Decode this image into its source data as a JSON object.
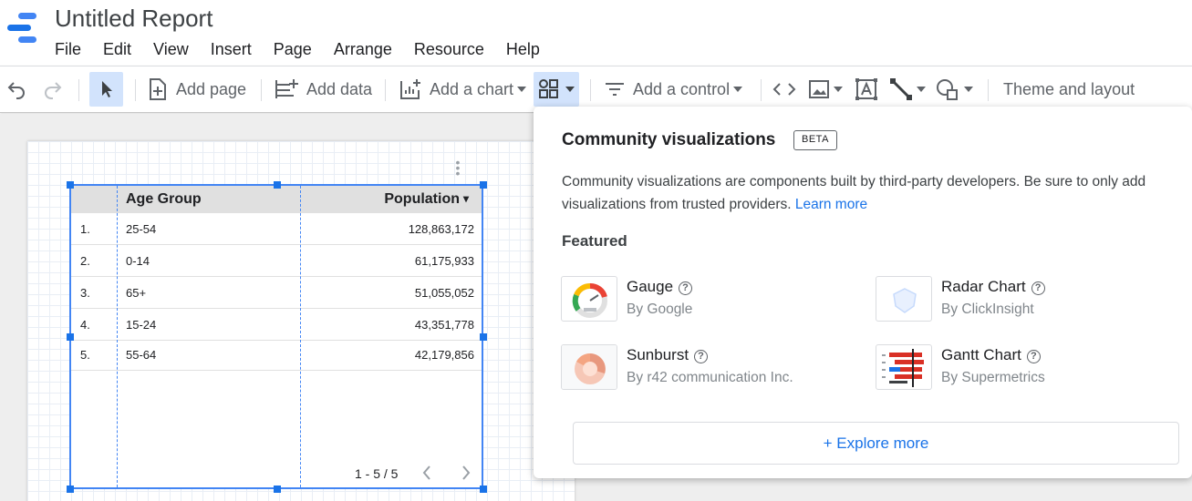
{
  "app": {
    "title": "Untitled Report"
  },
  "menu": [
    "File",
    "Edit",
    "View",
    "Insert",
    "Page",
    "Arrange",
    "Resource",
    "Help"
  ],
  "toolbar": {
    "add_page": "Add page",
    "add_data": "Add data",
    "add_chart": "Add a chart",
    "add_control": "Add a control",
    "theme_layout": "Theme and layout"
  },
  "table": {
    "columns": [
      "Age Group",
      "Population"
    ],
    "sort_indicator": "▾",
    "rows": [
      {
        "index": "1.",
        "age_group": "25-54",
        "population": "128,863,172"
      },
      {
        "index": "2.",
        "age_group": "0-14",
        "population": "61,175,933"
      },
      {
        "index": "3.",
        "age_group": "65+",
        "population": "51,055,052"
      },
      {
        "index": "4.",
        "age_group": "15-24",
        "population": "43,351,778"
      },
      {
        "index": "5.",
        "age_group": "55-64",
        "population": "42,179,856"
      }
    ],
    "pagination": "1 - 5 / 5"
  },
  "popover": {
    "title": "Community visualizations",
    "badge": "BETA",
    "description": "Community visualizations are components built by third-party developers. Be sure to only add visualizations from trusted providers.",
    "learn_more": "Learn more",
    "featured_heading": "Featured",
    "items": [
      {
        "name": "Gauge",
        "by": "By Google",
        "icon": "gauge-thumbnail"
      },
      {
        "name": "Radar Chart",
        "by": "By ClickInsight",
        "icon": "radar-thumbnail"
      },
      {
        "name": "Sunburst",
        "by": "By r42 communication Inc.",
        "icon": "sunburst-thumbnail"
      },
      {
        "name": "Gantt Chart",
        "by": "By Supermetrics",
        "icon": "gantt-thumbnail"
      }
    ],
    "help_glyph": "?",
    "explore_more": "+ Explore more"
  },
  "colors": {
    "accent": "#1a73e8",
    "selection": "#4285f4",
    "selected_tool_bg": "#d2e3fc"
  }
}
